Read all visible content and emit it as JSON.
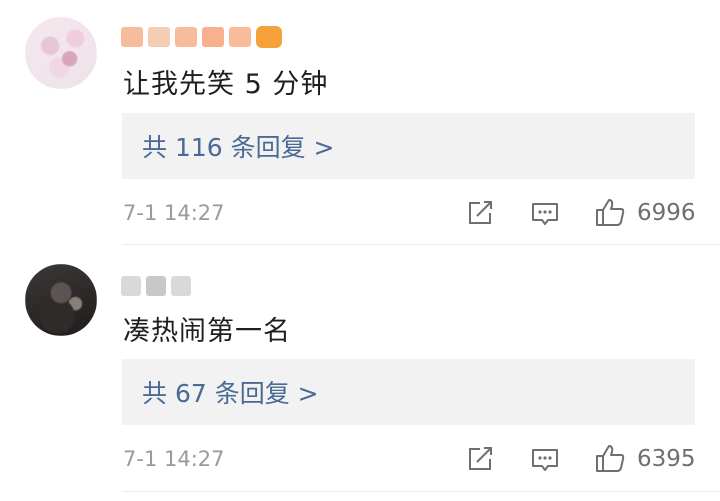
{
  "comments": [
    {
      "text": "让我先笑 5 分钟",
      "reply_label": "共 116 条回复 >",
      "timestamp": "7-1 14:27",
      "like_count": "6996"
    },
    {
      "text": "凑热闹第一名",
      "reply_label": "共 67 条回复 >",
      "timestamp": "7-1 14:27",
      "like_count": "6395"
    }
  ],
  "icons": {
    "share": "share-icon",
    "comment": "comment-icon",
    "like": "thumbs-up-icon"
  },
  "colors": {
    "reply_link": "#4a6a96",
    "reply_bg": "#f2f2f2",
    "meta_text": "#9a9a9a"
  }
}
